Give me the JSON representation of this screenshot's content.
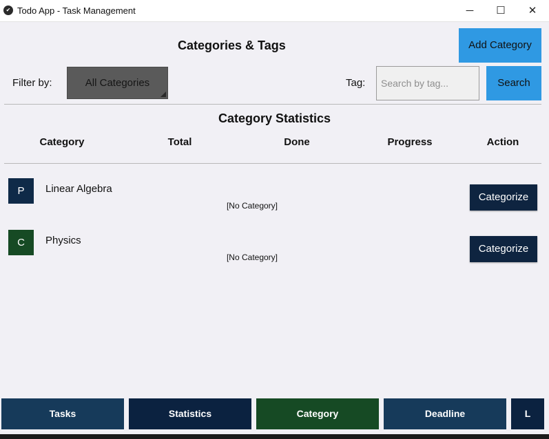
{
  "window": {
    "title": "Todo App - Task Management",
    "minimize_glyph": "─",
    "maximize_glyph": "☐",
    "close_glyph": "✕"
  },
  "header": {
    "title": "Categories & Tags",
    "add_category_label": "Add Category"
  },
  "filter": {
    "label": "Filter by:",
    "selected": "All Categories"
  },
  "tag": {
    "label": "Tag:",
    "placeholder": "Search by tag...",
    "value": "",
    "search_label": "Search"
  },
  "stats": {
    "title": "Category Statistics",
    "columns": [
      "Category",
      "Total",
      "Done",
      "Progress",
      "Action"
    ],
    "rows": [
      {
        "initial": "P",
        "name": "Linear Algebra",
        "category": "[No Category]",
        "action": "Categorize",
        "color": "#0f2a48"
      },
      {
        "initial": "C",
        "name": "Physics",
        "category": "[No Category]",
        "action": "Categorize",
        "color": "#164a24"
      }
    ]
  },
  "nav": {
    "items": [
      {
        "label": "Tasks",
        "color": "#163a5a"
      },
      {
        "label": "Statistics",
        "color": "#0b2240"
      },
      {
        "label": "Category",
        "color": "#164a24"
      },
      {
        "label": "Deadline",
        "color": "#163a5a"
      },
      {
        "label": "L",
        "color": "#0b2240"
      }
    ]
  },
  "colors": {
    "accent": "#2f99e3",
    "background": "#f1f0f5",
    "dropdown": "#5a5a5a"
  }
}
